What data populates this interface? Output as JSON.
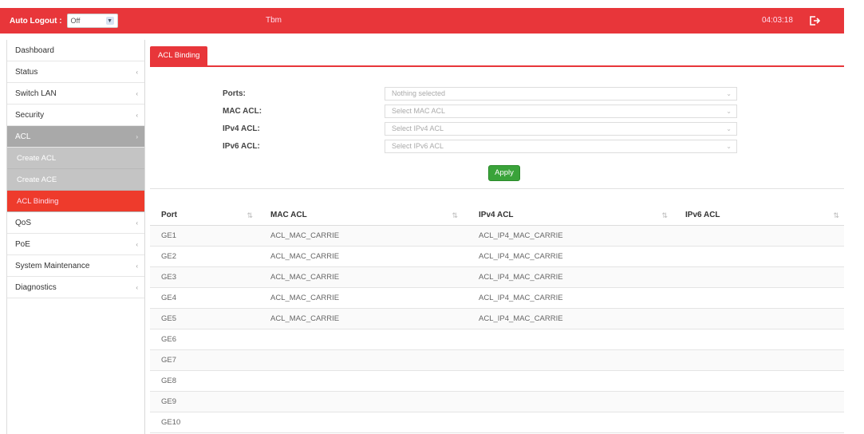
{
  "topbar": {
    "auto_logout_label": "Auto Logout :",
    "auto_logout_value": "Off",
    "title": "Tbm",
    "time": "04:03:18"
  },
  "sidebar": {
    "items": [
      {
        "label": "Dashboard",
        "arrow": ""
      },
      {
        "label": "Status",
        "arrow": "‹"
      },
      {
        "label": "Switch LAN",
        "arrow": "‹"
      },
      {
        "label": "Security",
        "arrow": "‹"
      },
      {
        "label": "ACL",
        "arrow": "›"
      },
      {
        "label": "Create ACL"
      },
      {
        "label": "Create ACE"
      },
      {
        "label": "ACL Binding"
      },
      {
        "label": "QoS",
        "arrow": "‹"
      },
      {
        "label": "PoE",
        "arrow": "‹"
      },
      {
        "label": "System Maintenance",
        "arrow": "‹"
      },
      {
        "label": "Diagnostics",
        "arrow": "‹"
      }
    ]
  },
  "main": {
    "tab": "ACL Binding",
    "form": {
      "ports_label": "Ports:",
      "ports_placeholder": "Nothing selected",
      "mac_label": "MAC ACL:",
      "mac_placeholder": "Select MAC ACL",
      "ipv4_label": "IPv4 ACL:",
      "ipv4_placeholder": "Select IPv4 ACL",
      "ipv6_label": "IPv6 ACL:",
      "ipv6_placeholder": "Select IPv6 ACL",
      "apply": "Apply"
    },
    "table": {
      "headers": [
        "Port",
        "MAC ACL",
        "IPv4 ACL",
        "IPv6 ACL"
      ],
      "rows": [
        [
          "GE1",
          "ACL_MAC_CARRIE",
          "ACL_IP4_MAC_CARRIE",
          ""
        ],
        [
          "GE2",
          "ACL_MAC_CARRIE",
          "ACL_IP4_MAC_CARRIE",
          ""
        ],
        [
          "GE3",
          "ACL_MAC_CARRIE",
          "ACL_IP4_MAC_CARRIE",
          ""
        ],
        [
          "GE4",
          "ACL_MAC_CARRIE",
          "ACL_IP4_MAC_CARRIE",
          ""
        ],
        [
          "GE5",
          "ACL_MAC_CARRIE",
          "ACL_IP4_MAC_CARRIE",
          ""
        ],
        [
          "GE6",
          "",
          "",
          ""
        ],
        [
          "GE7",
          "",
          "",
          ""
        ],
        [
          "GE8",
          "",
          "",
          ""
        ],
        [
          "GE9",
          "",
          "",
          ""
        ],
        [
          "GE10",
          "",
          "",
          ""
        ]
      ]
    }
  },
  "colors": {
    "brand_red": "#e8363a",
    "apply_green": "#3aa33a",
    "sidebar_active": "#a9a9a9"
  }
}
